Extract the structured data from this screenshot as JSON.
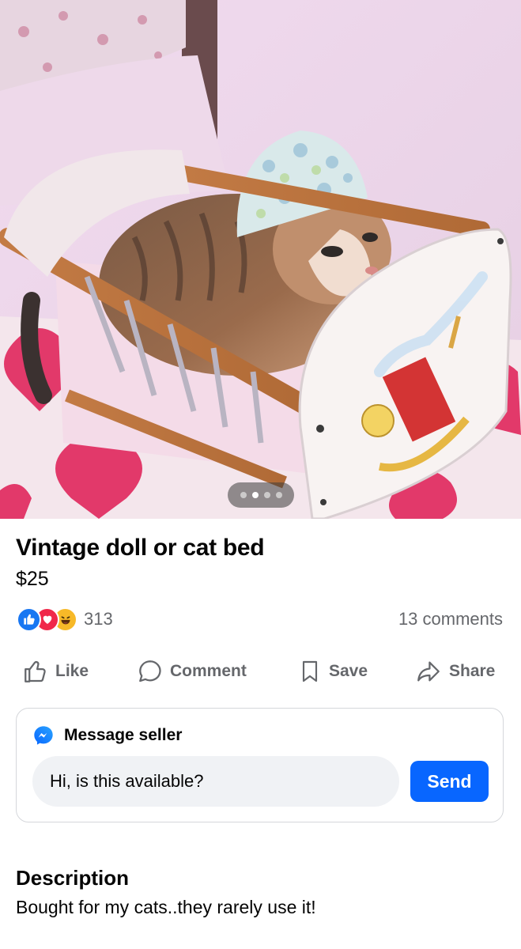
{
  "photo": {
    "description_alt": "",
    "carousel": {
      "count": 4,
      "active_index": 1
    }
  },
  "listing": {
    "title": "Vintage doll or cat bed",
    "price": "$25"
  },
  "engagement": {
    "reactions": [
      "like-icon",
      "love-icon",
      "haha-icon"
    ],
    "reaction_count": "313",
    "comments": "13 comments"
  },
  "actions": {
    "like": "Like",
    "comment": "Comment",
    "save": "Save",
    "share": "Share"
  },
  "message_seller": {
    "title": "Message seller",
    "input_value": "Hi, is this available?",
    "send_label": "Send"
  },
  "description": {
    "heading": "Description",
    "text": "Bought for my cats..they rarely use it!"
  },
  "colors": {
    "accent": "#0866ff",
    "muted_text": "#65676b",
    "input_bg": "#f0f2f5"
  }
}
